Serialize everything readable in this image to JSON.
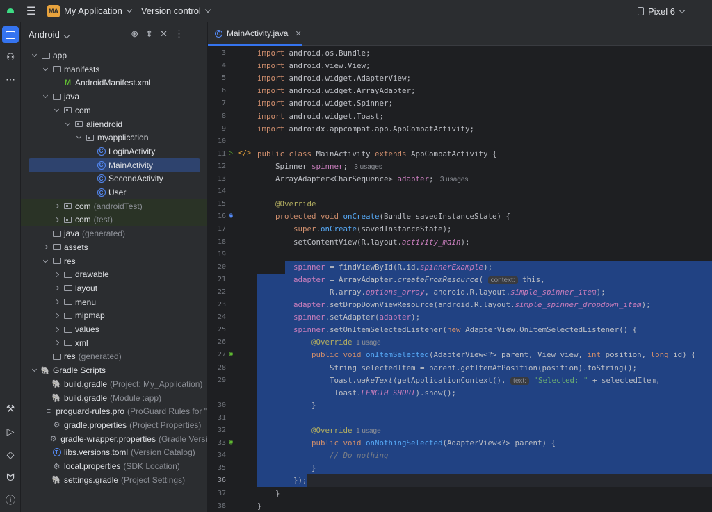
{
  "titlebar": {
    "project_badge": "MA",
    "project_name": "My Application",
    "vcs_label": "Version control",
    "device": "Pixel 6"
  },
  "panel": {
    "title": "Android",
    "tree": [
      {
        "depth": 0,
        "arrow": "down",
        "icon": "folder",
        "label": "app",
        "muted": ""
      },
      {
        "depth": 1,
        "arrow": "down",
        "icon": "folder",
        "label": "manifests",
        "muted": ""
      },
      {
        "depth": 2,
        "arrow": "",
        "icon": "manifest",
        "label": "AndroidManifest.xml",
        "muted": ""
      },
      {
        "depth": 1,
        "arrow": "down",
        "icon": "folder",
        "label": "java",
        "muted": ""
      },
      {
        "depth": 2,
        "arrow": "down",
        "icon": "package",
        "label": "com",
        "muted": ""
      },
      {
        "depth": 3,
        "arrow": "down",
        "icon": "package",
        "label": "aliendroid",
        "muted": ""
      },
      {
        "depth": 4,
        "arrow": "down",
        "icon": "package",
        "label": "myapplication",
        "muted": ""
      },
      {
        "depth": 5,
        "arrow": "",
        "icon": "class",
        "label": "LoginActivity",
        "muted": ""
      },
      {
        "depth": 5,
        "arrow": "",
        "icon": "class",
        "label": "MainActivity",
        "muted": "",
        "selected": true
      },
      {
        "depth": 5,
        "arrow": "",
        "icon": "class",
        "label": "SecondActivity",
        "muted": ""
      },
      {
        "depth": 5,
        "arrow": "",
        "icon": "class",
        "label": "User",
        "muted": ""
      },
      {
        "depth": 2,
        "arrow": "right",
        "icon": "package",
        "label": "com",
        "muted": "(androidTest)",
        "test": true
      },
      {
        "depth": 2,
        "arrow": "right",
        "icon": "package",
        "label": "com",
        "muted": "(test)",
        "test": true
      },
      {
        "depth": 1,
        "arrow": "",
        "icon": "folder",
        "label": "java",
        "muted": "(generated)"
      },
      {
        "depth": 1,
        "arrow": "right",
        "icon": "folder",
        "label": "assets",
        "muted": ""
      },
      {
        "depth": 1,
        "arrow": "down",
        "icon": "folder",
        "label": "res",
        "muted": ""
      },
      {
        "depth": 2,
        "arrow": "right",
        "icon": "folder",
        "label": "drawable",
        "muted": ""
      },
      {
        "depth": 2,
        "arrow": "right",
        "icon": "folder",
        "label": "layout",
        "muted": ""
      },
      {
        "depth": 2,
        "arrow": "right",
        "icon": "folder",
        "label": "menu",
        "muted": ""
      },
      {
        "depth": 2,
        "arrow": "right",
        "icon": "folder",
        "label": "mipmap",
        "muted": ""
      },
      {
        "depth": 2,
        "arrow": "right",
        "icon": "folder",
        "label": "values",
        "muted": ""
      },
      {
        "depth": 2,
        "arrow": "right",
        "icon": "folder",
        "label": "xml",
        "muted": ""
      },
      {
        "depth": 1,
        "arrow": "",
        "icon": "folder",
        "label": "res",
        "muted": "(generated)"
      },
      {
        "depth": 0,
        "arrow": "down",
        "icon": "gradle",
        "label": "Gradle Scripts",
        "muted": ""
      },
      {
        "depth": 1,
        "arrow": "",
        "icon": "gradle",
        "label": "build.gradle",
        "muted": "(Project: My_Application)"
      },
      {
        "depth": 1,
        "arrow": "",
        "icon": "gradle",
        "label": "build.gradle",
        "muted": "(Module :app)"
      },
      {
        "depth": 1,
        "arrow": "",
        "icon": "text",
        "label": "proguard-rules.pro",
        "muted": "(ProGuard Rules for \""
      },
      {
        "depth": 1,
        "arrow": "",
        "icon": "gear",
        "label": "gradle.properties",
        "muted": "(Project Properties)"
      },
      {
        "depth": 1,
        "arrow": "",
        "icon": "gear",
        "label": "gradle-wrapper.properties",
        "muted": "(Gradle Versi"
      },
      {
        "depth": 1,
        "arrow": "",
        "icon": "toml",
        "label": "libs.versions.toml",
        "muted": "(Version Catalog)"
      },
      {
        "depth": 1,
        "arrow": "",
        "icon": "gear",
        "label": "local.properties",
        "muted": "(SDK Location)"
      },
      {
        "depth": 1,
        "arrow": "",
        "icon": "gradle",
        "label": "settings.gradle",
        "muted": "(Project Settings)"
      }
    ]
  },
  "editor": {
    "tab_label": "MainActivity.java",
    "current_line": 36,
    "lines": [
      {
        "n": "3",
        "parts": [
          [
            "kw",
            "import "
          ],
          [
            "plain",
            "android.os.Bundle;"
          ]
        ]
      },
      {
        "n": "4",
        "parts": [
          [
            "kw",
            "import "
          ],
          [
            "plain",
            "android.view.View;"
          ]
        ]
      },
      {
        "n": "5",
        "parts": [
          [
            "kw",
            "import "
          ],
          [
            "plain",
            "android.widget.AdapterView;"
          ]
        ]
      },
      {
        "n": "6",
        "parts": [
          [
            "kw",
            "import "
          ],
          [
            "plain",
            "android.widget.ArrayAdapter;"
          ]
        ]
      },
      {
        "n": "7",
        "parts": [
          [
            "kw",
            "import "
          ],
          [
            "plain",
            "android.widget.Spinner;"
          ]
        ]
      },
      {
        "n": "8",
        "parts": [
          [
            "kw",
            "import "
          ],
          [
            "plain",
            "android.widget.Toast;"
          ]
        ]
      },
      {
        "n": "9",
        "parts": [
          [
            "kw",
            "import "
          ],
          [
            "plain",
            "androidx.appcompat.app.AppCompatActivity;"
          ]
        ]
      },
      {
        "n": "10",
        "parts": []
      },
      {
        "n": "11",
        "parts": [
          [
            "kw",
            "public class "
          ],
          [
            "plain",
            "MainActivity "
          ],
          [
            "kw",
            "extends "
          ],
          [
            "plain",
            "AppCompatActivity {"
          ]
        ]
      },
      {
        "n": "12",
        "parts": [
          [
            "plain",
            "    Spinner "
          ],
          [
            "fld",
            "spinner"
          ],
          [
            "plain",
            "; "
          ],
          [
            "hint",
            " 3 usages"
          ]
        ]
      },
      {
        "n": "13",
        "parts": [
          [
            "plain",
            "    ArrayAdapter<CharSequence> "
          ],
          [
            "fld",
            "adapter"
          ],
          [
            "plain",
            "; "
          ],
          [
            "hint",
            " 3 usages"
          ]
        ]
      },
      {
        "n": "14",
        "parts": []
      },
      {
        "n": "15",
        "parts": [
          [
            "ann",
            "    @Override"
          ]
        ]
      },
      {
        "n": "16",
        "parts": [
          [
            "kw",
            "    protected void "
          ],
          [
            "fn",
            "onCreate"
          ],
          [
            "plain",
            "(Bundle savedInstanceState) {"
          ]
        ]
      },
      {
        "n": "17",
        "parts": [
          [
            "kw",
            "        super"
          ],
          [
            "plain",
            "."
          ],
          [
            "fn",
            "onCreate"
          ],
          [
            "plain",
            "(savedInstanceState);"
          ]
        ]
      },
      {
        "n": "18",
        "parts": [
          [
            "plain",
            "        setContentView(R.layout."
          ],
          [
            "fldit",
            "activity_main"
          ],
          [
            "plain",
            ");"
          ]
        ]
      },
      {
        "n": "19",
        "parts": []
      },
      {
        "n": "20",
        "parts": [
          [
            "plain",
            "        "
          ],
          [
            "fld",
            "spinner"
          ],
          [
            "plain",
            " = findViewById(R.id."
          ],
          [
            "fldit",
            "spinnerExample"
          ],
          [
            "plain",
            ");"
          ]
        ]
      },
      {
        "n": "21",
        "parts": [
          [
            "plain",
            "        "
          ],
          [
            "fld",
            "adapter"
          ],
          [
            "plain",
            " = ArrayAdapter."
          ],
          [
            "it",
            "createFromResource"
          ],
          [
            "plain",
            "( "
          ],
          [
            "hintbox",
            "context:"
          ],
          [
            "plain",
            " this,"
          ]
        ]
      },
      {
        "n": "22",
        "parts": [
          [
            "plain",
            "                R.array."
          ],
          [
            "fldit",
            "options_array"
          ],
          [
            "plain",
            ", android.R.layout."
          ],
          [
            "fldit",
            "simple_spinner_item"
          ],
          [
            "plain",
            ");"
          ]
        ]
      },
      {
        "n": "23",
        "parts": [
          [
            "plain",
            "        "
          ],
          [
            "fld",
            "adapter"
          ],
          [
            "plain",
            ".setDropDownViewResource(android.R.layout."
          ],
          [
            "fldit",
            "simple_spinner_dropdown_item"
          ],
          [
            "plain",
            ");"
          ]
        ]
      },
      {
        "n": "24",
        "parts": [
          [
            "plain",
            "        "
          ],
          [
            "fld",
            "spinner"
          ],
          [
            "plain",
            ".setAdapter("
          ],
          [
            "fld",
            "adapter"
          ],
          [
            "plain",
            ");"
          ]
        ]
      },
      {
        "n": "25",
        "parts": [
          [
            "plain",
            "        "
          ],
          [
            "fld",
            "spinner"
          ],
          [
            "plain",
            ".setOnItemSelectedListener("
          ],
          [
            "kw",
            "new "
          ],
          [
            "plain",
            "AdapterView.OnItemSelectedListener() {"
          ]
        ]
      },
      {
        "n": "26",
        "parts": [
          [
            "ann",
            "            @Override"
          ],
          [
            "hint",
            "  1 usage"
          ]
        ]
      },
      {
        "n": "27",
        "parts": [
          [
            "kw",
            "            public void "
          ],
          [
            "fn",
            "onItemSelected"
          ],
          [
            "plain",
            "(AdapterView<?> parent, View view, "
          ],
          [
            "kw",
            "int "
          ],
          [
            "plain",
            "position, "
          ],
          [
            "kw",
            "long "
          ],
          [
            "plain",
            "id) {"
          ]
        ]
      },
      {
        "n": "28",
        "parts": [
          [
            "plain",
            "                String selectedItem = parent.getItemAtPosition(position).toString();"
          ]
        ]
      },
      {
        "n": "29",
        "parts": [
          [
            "plain",
            "                Toast."
          ],
          [
            "it",
            "makeText"
          ],
          [
            "plain",
            "(getApplicationContext(), "
          ],
          [
            "hintbox",
            "text:"
          ],
          [
            "str",
            " \"Selected: \""
          ],
          [
            "plain",
            " + selectedItem,"
          ]
        ]
      },
      {
        "n": "",
        "parts": [
          [
            "plain",
            "                 Toast."
          ],
          [
            "fldit",
            "LENGTH_SHORT"
          ],
          [
            "plain",
            ").show();"
          ]
        ]
      },
      {
        "n": "30",
        "parts": [
          [
            "plain",
            "            }"
          ]
        ]
      },
      {
        "n": "31",
        "parts": []
      },
      {
        "n": "32",
        "parts": [
          [
            "ann",
            "            @Override"
          ],
          [
            "hint",
            "  1 usage"
          ]
        ]
      },
      {
        "n": "33",
        "parts": [
          [
            "kw",
            "            public void "
          ],
          [
            "fn",
            "onNothingSelected"
          ],
          [
            "plain",
            "(AdapterView<?> parent) {"
          ]
        ]
      },
      {
        "n": "34",
        "parts": [
          [
            "cmt",
            "                // Do nothing"
          ]
        ]
      },
      {
        "n": "35",
        "parts": [
          [
            "plain",
            "            }"
          ]
        ]
      },
      {
        "n": "36",
        "parts": [
          [
            "plain",
            "        });"
          ]
        ]
      },
      {
        "n": "37",
        "parts": [
          [
            "plain",
            "    }"
          ]
        ]
      },
      {
        "n": "38",
        "parts": [
          [
            "plain",
            "}"
          ]
        ]
      }
    ]
  }
}
